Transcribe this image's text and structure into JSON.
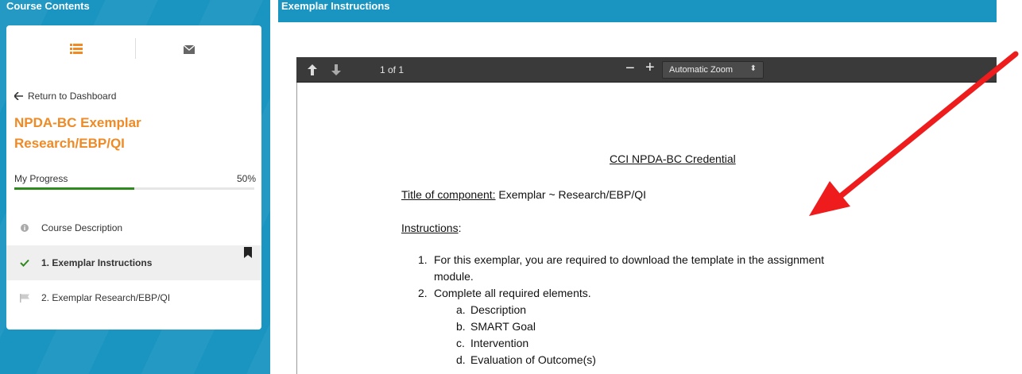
{
  "sidebar": {
    "header": "Course Contents",
    "return_label": "Return to Dashboard",
    "course_title": "NPDA-BC Exemplar Research/EBP/QI",
    "progress_label": "My Progress",
    "progress_percent_text": "50%",
    "progress_value": 0.5,
    "items": [
      {
        "label": "Course Description",
        "icon": "info-icon"
      },
      {
        "label": "1.  Exemplar Instructions",
        "icon": "check-icon",
        "active": true,
        "bookmarked": true
      },
      {
        "label": "2.  Exemplar Research/EBP/QI",
        "icon": "flag-icon"
      }
    ],
    "icons": {
      "list": "list-icon",
      "mail": "envelope-icon"
    }
  },
  "content": {
    "header": "Exemplar Instructions"
  },
  "pdf_viewer": {
    "page_indicator": "1 of 1",
    "zoom_label": "Automatic Zoom",
    "zoom_minus": "−",
    "zoom_plus": "+",
    "document": {
      "heading": "CCI NPDA-BC Credential",
      "component_label": "Title of component:",
      "component_value": " Exemplar ~ Research/EBP/QI",
      "instructions_label": "Instructions",
      "instructions_colon": ":",
      "list": [
        {
          "n": "1.",
          "text": "For this exemplar, you are required to download the template in the assignment module."
        },
        {
          "n": "2.",
          "text": "Complete all required elements."
        }
      ],
      "sublist": [
        {
          "n": "a.",
          "text": "Description"
        },
        {
          "n": "b.",
          "text": "SMART Goal"
        },
        {
          "n": "c.",
          "text": "Intervention"
        },
        {
          "n": "d.",
          "text": "Evaluation of Outcome(s)"
        }
      ]
    }
  },
  "colors": {
    "blue": "#1a95c2",
    "orange": "#ef8a25",
    "progress_green": "#2e8a1e",
    "toolbar": "#3a3a3a",
    "arrow_red": "#ee1c1c"
  }
}
